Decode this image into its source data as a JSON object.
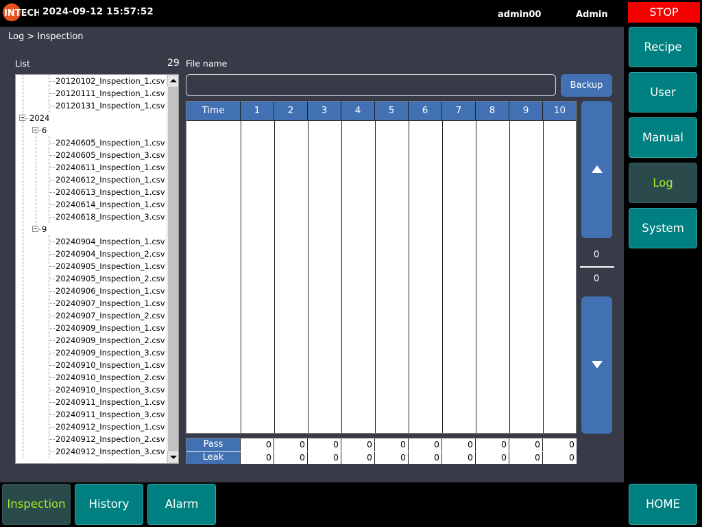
{
  "header": {
    "logo_text": "INTECH",
    "datetime": "2024-09-12 15:57:52",
    "user_id": "admin00",
    "user_level": "Admin"
  },
  "breadcrumb": "Log > Inspection",
  "list": {
    "label": "List",
    "count": "29",
    "tree": [
      {
        "level": 2,
        "type": "file",
        "label": "20120102_Inspection_1.csv"
      },
      {
        "level": 2,
        "type": "file",
        "label": "20120111_Inspection_1.csv"
      },
      {
        "level": 2,
        "type": "file",
        "label": "20120131_Inspection_1.csv"
      },
      {
        "level": 0,
        "type": "folder",
        "label": "2024"
      },
      {
        "level": 1,
        "type": "folder",
        "label": "6"
      },
      {
        "level": 2,
        "type": "file",
        "label": "20240605_Inspection_1.csv"
      },
      {
        "level": 2,
        "type": "file",
        "label": "20240605_Inspection_3.csv"
      },
      {
        "level": 2,
        "type": "file",
        "label": "20240611_Inspection_1.csv"
      },
      {
        "level": 2,
        "type": "file",
        "label": "20240612_Inspection_1.csv"
      },
      {
        "level": 2,
        "type": "file",
        "label": "20240613_Inspection_1.csv"
      },
      {
        "level": 2,
        "type": "file",
        "label": "20240614_Inspection_1.csv"
      },
      {
        "level": 2,
        "type": "file",
        "label": "20240618_Inspection_3.csv"
      },
      {
        "level": 1,
        "type": "folder",
        "label": "9"
      },
      {
        "level": 2,
        "type": "file",
        "label": "20240904_Inspection_1.csv"
      },
      {
        "level": 2,
        "type": "file",
        "label": "20240904_Inspection_2.csv"
      },
      {
        "level": 2,
        "type": "file",
        "label": "20240905_Inspection_1.csv"
      },
      {
        "level": 2,
        "type": "file",
        "label": "20240905_Inspection_2.csv"
      },
      {
        "level": 2,
        "type": "file",
        "label": "20240906_Inspection_1.csv"
      },
      {
        "level": 2,
        "type": "file",
        "label": "20240907_Inspection_1.csv"
      },
      {
        "level": 2,
        "type": "file",
        "label": "20240907_Inspection_2.csv"
      },
      {
        "level": 2,
        "type": "file",
        "label": "20240909_Inspection_1.csv"
      },
      {
        "level": 2,
        "type": "file",
        "label": "20240909_Inspection_2.csv"
      },
      {
        "level": 2,
        "type": "file",
        "label": "20240909_Inspection_3.csv"
      },
      {
        "level": 2,
        "type": "file",
        "label": "20240910_Inspection_1.csv"
      },
      {
        "level": 2,
        "type": "file",
        "label": "20240910_Inspection_2.csv"
      },
      {
        "level": 2,
        "type": "file",
        "label": "20240910_Inspection_3.csv"
      },
      {
        "level": 2,
        "type": "file",
        "label": "20240911_Inspection_1.csv"
      },
      {
        "level": 2,
        "type": "file",
        "label": "20240911_Inspection_3.csv"
      },
      {
        "level": 2,
        "type": "file",
        "label": "20240912_Inspection_1.csv"
      },
      {
        "level": 2,
        "type": "file",
        "label": "20240912_Inspection_2.csv"
      },
      {
        "level": 2,
        "type": "file",
        "label": "20240912_Inspection_3.csv"
      }
    ]
  },
  "file": {
    "label": "File name",
    "value": "",
    "backup_label": "Backup"
  },
  "grid": {
    "headers": [
      "Time",
      "1",
      "2",
      "3",
      "4",
      "5",
      "6",
      "7",
      "8",
      "9",
      "10"
    ],
    "rows": []
  },
  "summary": {
    "rows": [
      {
        "label": "Pass",
        "values": [
          "0",
          "0",
          "0",
          "0",
          "0",
          "0",
          "0",
          "0",
          "0",
          "0"
        ]
      },
      {
        "label": "Leak",
        "values": [
          "0",
          "0",
          "0",
          "0",
          "0",
          "0",
          "0",
          "0",
          "0",
          "0"
        ]
      }
    ]
  },
  "pager": {
    "current": "0",
    "total": "0"
  },
  "stop_label": "STOP",
  "menu": [
    {
      "label": "Recipe",
      "active": false
    },
    {
      "label": "User",
      "active": false
    },
    {
      "label": "Manual",
      "active": false
    },
    {
      "label": "Log",
      "active": true
    },
    {
      "label": "System",
      "active": false
    }
  ],
  "tabs": [
    {
      "label": "Inspection",
      "active": true
    },
    {
      "label": "History",
      "active": false
    },
    {
      "label": "Alarm",
      "active": false
    }
  ],
  "home_label": "HOME",
  "colors": {
    "panel_bg": "#383b47",
    "accent_blue": "#4171b3",
    "teal": "#008080",
    "active_bg": "#2b4a4c",
    "active_text": "#a6f02b",
    "stop_red": "#f50000"
  }
}
